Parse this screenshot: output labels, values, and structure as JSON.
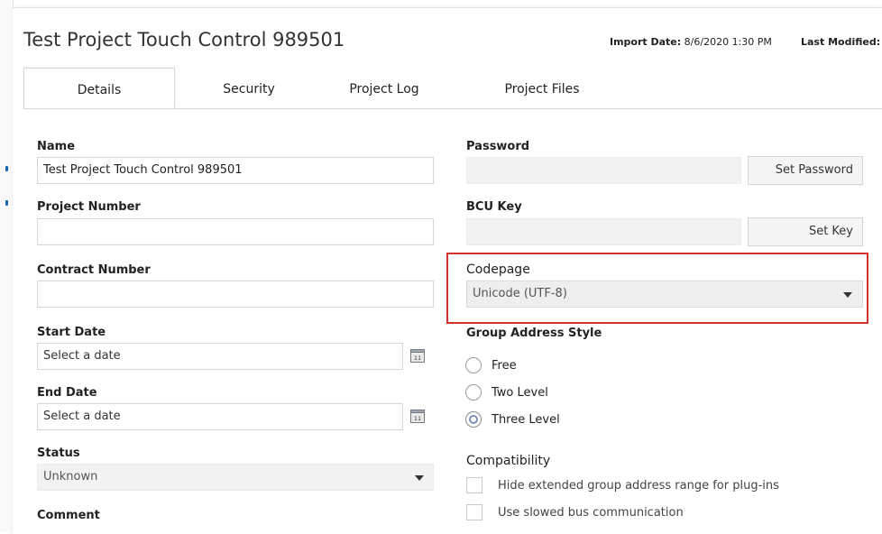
{
  "window": {
    "title": "Test Project Touch Control 989501",
    "import_date_label": "Import Date:",
    "import_date_value": "8/6/2020 1:30 PM",
    "last_modified_label": "Last Modified:"
  },
  "tabs": [
    {
      "label": "Details",
      "active": true
    },
    {
      "label": "Security",
      "active": false
    },
    {
      "label": "Project Log",
      "active": false
    },
    {
      "label": "Project Files",
      "active": false
    }
  ],
  "left": {
    "name_label": "Name",
    "name_value": "Test Project Touch Control 989501",
    "project_number_label": "Project Number",
    "project_number_value": "",
    "contract_number_label": "Contract Number",
    "contract_number_value": "",
    "start_date_label": "Start Date",
    "start_date_placeholder": "Select a date",
    "end_date_label": "End Date",
    "end_date_placeholder": "Select a date",
    "status_label": "Status",
    "status_value": "Unknown",
    "comment_label": "Comment"
  },
  "right": {
    "password_label": "Password",
    "set_password_button": "Set Password",
    "bcu_key_label": "BCU Key",
    "set_key_button": "Set Key",
    "codepage_label": "Codepage",
    "codepage_value": "Unicode (UTF-8)",
    "group_address_style_label": "Group Address Style",
    "group_address_options": [
      {
        "label": "Free",
        "selected": false
      },
      {
        "label": "Two Level",
        "selected": false
      },
      {
        "label": "Three Level",
        "selected": true
      }
    ],
    "compatibility_label": "Compatibility",
    "compatibility_options": [
      {
        "label": "Hide extended group address range for plug-ins",
        "checked": false
      },
      {
        "label": "Use slowed bus communication",
        "checked": false
      }
    ]
  },
  "colors": {
    "highlight": "#d32f2f",
    "accent": "#1565c0"
  }
}
